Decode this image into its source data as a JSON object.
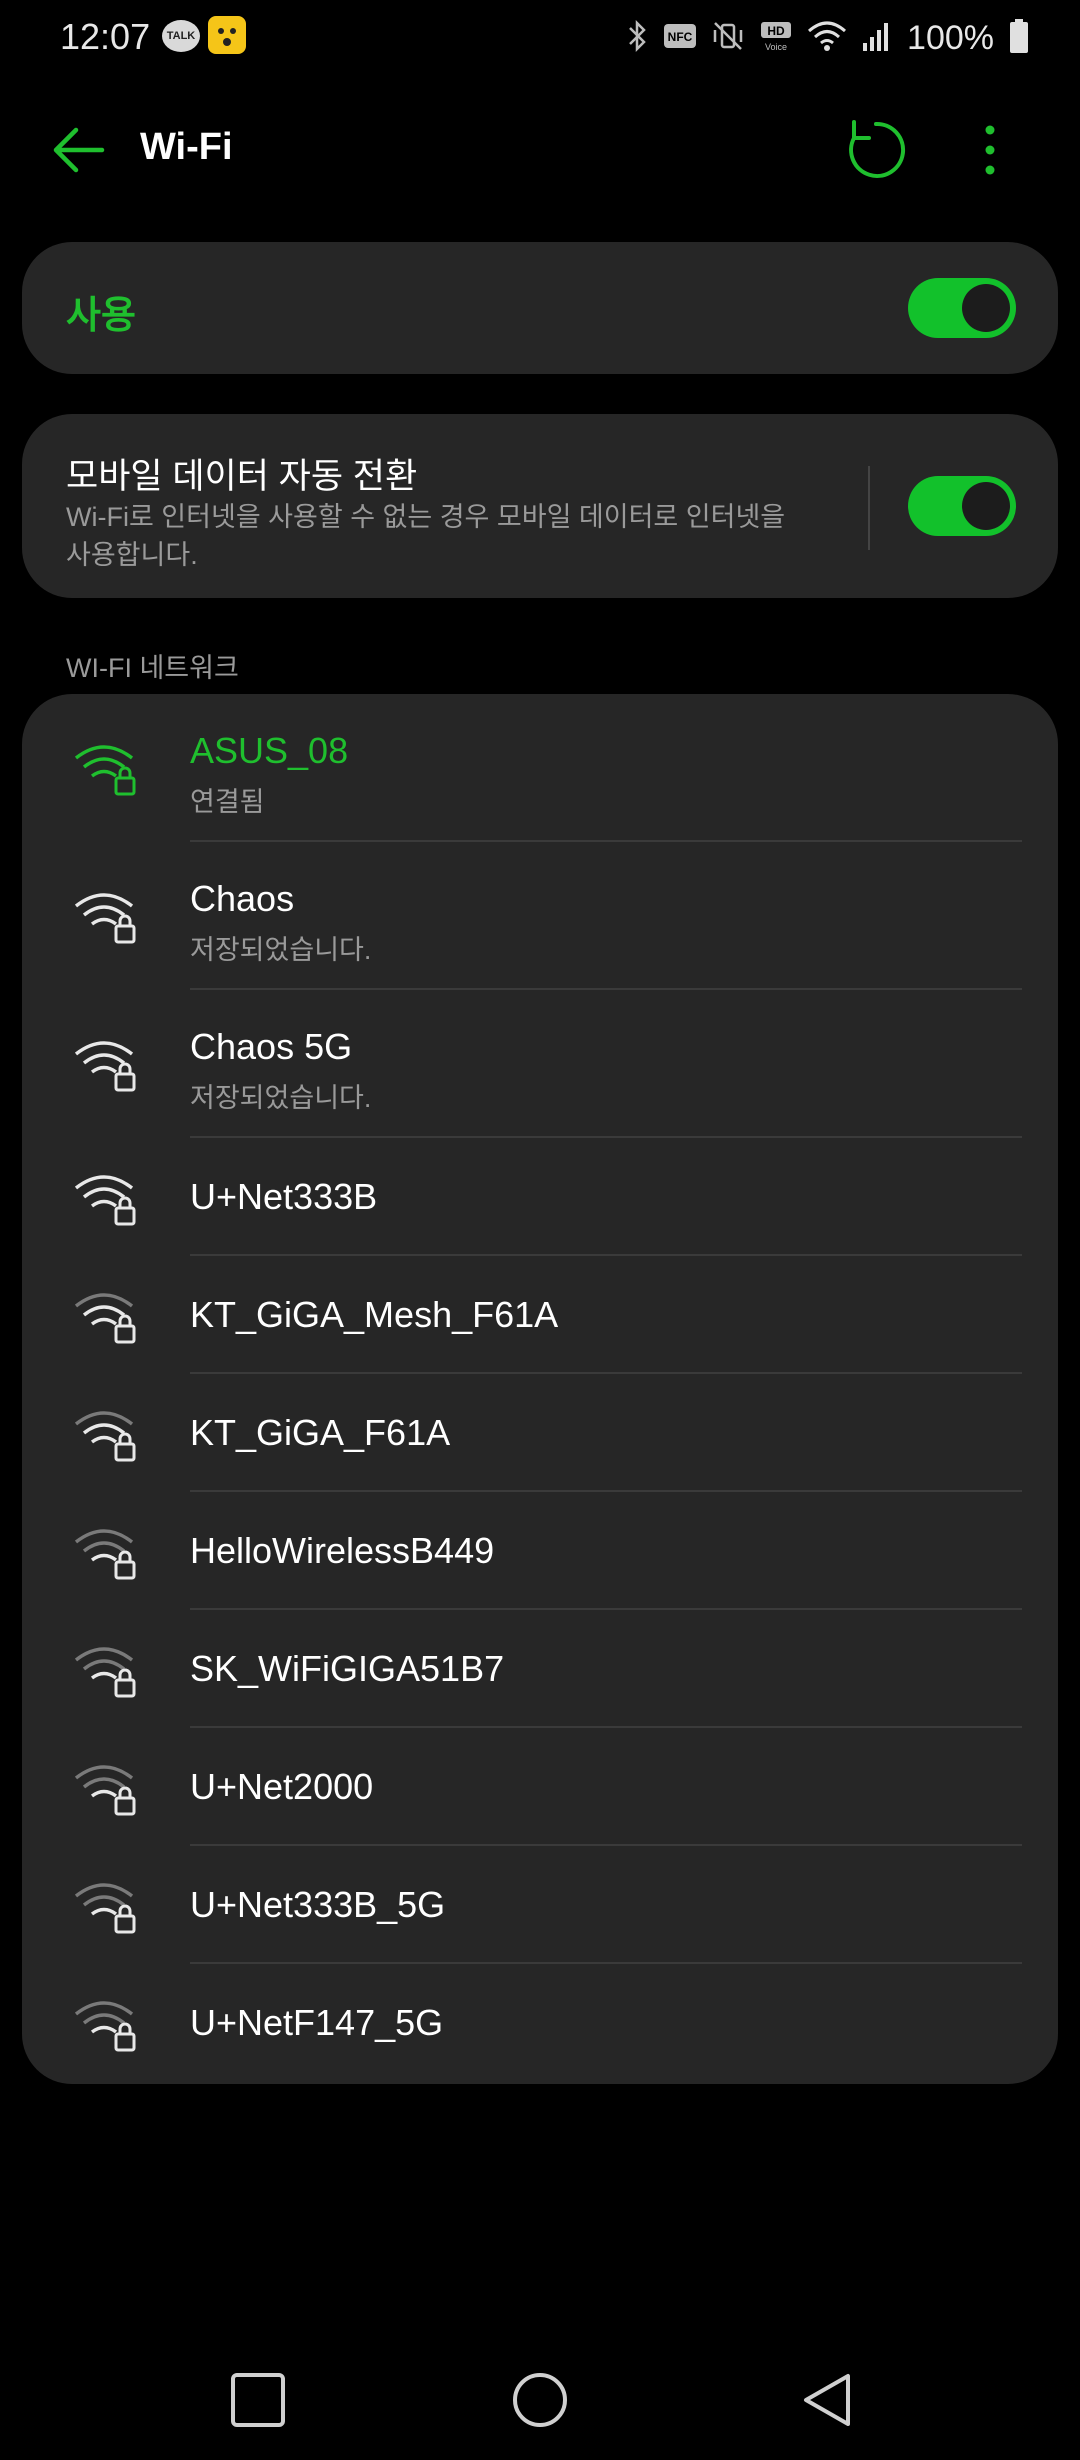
{
  "status_bar": {
    "time": "12:07",
    "talk_badge": "TALK",
    "battery_text": "100%"
  },
  "appbar": {
    "title": "Wi-Fi",
    "accent": "#1fbf2e"
  },
  "wifi_toggle": {
    "label": "사용",
    "on": true
  },
  "mobile_switch": {
    "title": "모바일 데이터 자동 전환",
    "description": "Wi-Fi로 인터넷을 사용할 수 없는 경우 모바일 데이터로 인터넷을 사용합니다.",
    "on": true
  },
  "networks_header": "WI-FI 네트워크",
  "networks": [
    {
      "name": "ASUS_08",
      "status": "연결됨",
      "connected": true
    },
    {
      "name": "Chaos",
      "status": "저장되었습니다."
    },
    {
      "name": "Chaos 5G",
      "status": "저장되었습니다."
    },
    {
      "name": "U+Net333B"
    },
    {
      "name": "KT_GiGA_Mesh_F61A"
    },
    {
      "name": "KT_GiGA_F61A"
    },
    {
      "name": "HelloWirelessB449"
    },
    {
      "name": "SK_WiFiGIGA51B7"
    },
    {
      "name": "U+Net2000"
    },
    {
      "name": "U+Net333B_5G"
    },
    {
      "name": "U+NetF147_5G"
    }
  ]
}
